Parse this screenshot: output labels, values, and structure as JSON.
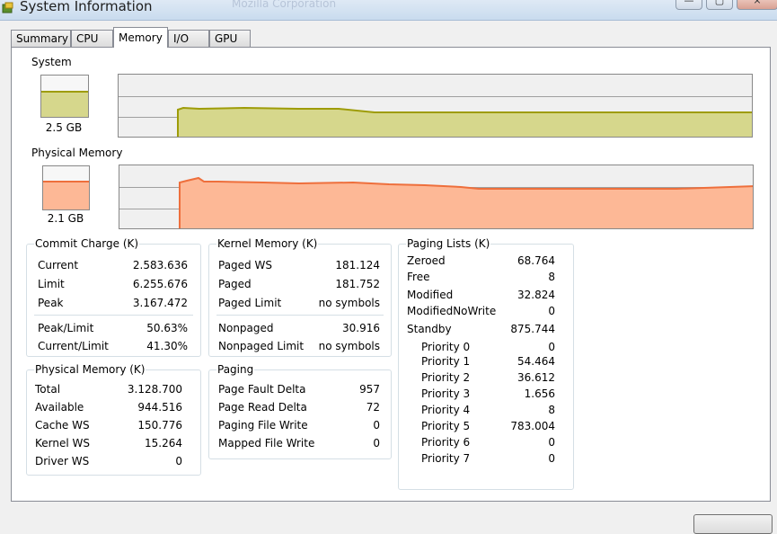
{
  "window": {
    "title": "System Information",
    "ghost_text": "Mozilla Corporation",
    "minimize_symbol": "—",
    "maximize_symbol": "▢",
    "close_symbol": "×"
  },
  "tabs": [
    {
      "label": "Summary"
    },
    {
      "label": "CPU"
    },
    {
      "label": "Memory",
      "active": true
    },
    {
      "label": "I/O"
    },
    {
      "label": "GPU"
    }
  ],
  "system": {
    "title": "System",
    "gauge_label": "2.5 GB",
    "gauge_fraction": 0.62,
    "color_fill": "#d6d78c",
    "color_line": "#9e9c08"
  },
  "physical": {
    "title": "Physical Memory",
    "gauge_label": "2.1 GB",
    "gauge_fraction": 0.67,
    "color_fill": "#fdb896",
    "color_line": "#ee6f3c"
  },
  "commit_charge": {
    "title": "Commit Charge (K)",
    "rows": [
      {
        "label": "Current",
        "value": "2.583.636"
      },
      {
        "label": "Limit",
        "value": "6.255.676"
      },
      {
        "label": "Peak",
        "value": "3.167.472"
      },
      {
        "label": "Peak/Limit",
        "value": "50.63%"
      },
      {
        "label": "Current/Limit",
        "value": "41.30%"
      }
    ]
  },
  "physical_memory": {
    "title": "Physical Memory (K)",
    "rows": [
      {
        "label": "Total",
        "value": "3.128.700"
      },
      {
        "label": "Available",
        "value": "944.516"
      },
      {
        "label": "Cache WS",
        "value": "150.776"
      },
      {
        "label": "Kernel WS",
        "value": "15.264"
      },
      {
        "label": "Driver WS",
        "value": "0"
      }
    ]
  },
  "kernel_memory": {
    "title": "Kernel Memory (K)",
    "rows": [
      {
        "label": "Paged WS",
        "value": "181.124"
      },
      {
        "label": "Paged",
        "value": "181.752"
      },
      {
        "label": "Paged Limit",
        "value": "no symbols"
      },
      {
        "label": "Nonpaged",
        "value": "30.916"
      },
      {
        "label": "Nonpaged Limit",
        "value": "no symbols"
      }
    ]
  },
  "paging": {
    "title": "Paging",
    "rows": [
      {
        "label": "Page Fault Delta",
        "value": "957"
      },
      {
        "label": "Page Read Delta",
        "value": "72"
      },
      {
        "label": "Paging File Write",
        "value": "0"
      },
      {
        "label": "Mapped File Write",
        "value": "0"
      }
    ]
  },
  "paging_lists": {
    "title": "Paging Lists (K)",
    "rows": [
      {
        "label": "Zeroed",
        "value": "68.764"
      },
      {
        "label": "Free",
        "value": "8"
      },
      {
        "label": "Modified",
        "value": "32.824"
      },
      {
        "label": "ModifiedNoWrite",
        "value": "0"
      },
      {
        "label": "Standby",
        "value": "875.744"
      },
      {
        "label": "Priority 0",
        "value": "0"
      },
      {
        "label": "Priority 1",
        "value": "54.464"
      },
      {
        "label": "Priority 2",
        "value": "36.612"
      },
      {
        "label": "Priority 3",
        "value": "1.656"
      },
      {
        "label": "Priority 4",
        "value": "8"
      },
      {
        "label": "Priority 5",
        "value": "783.004"
      },
      {
        "label": "Priority 6",
        "value": "0"
      },
      {
        "label": "Priority 7",
        "value": "0"
      }
    ]
  }
}
